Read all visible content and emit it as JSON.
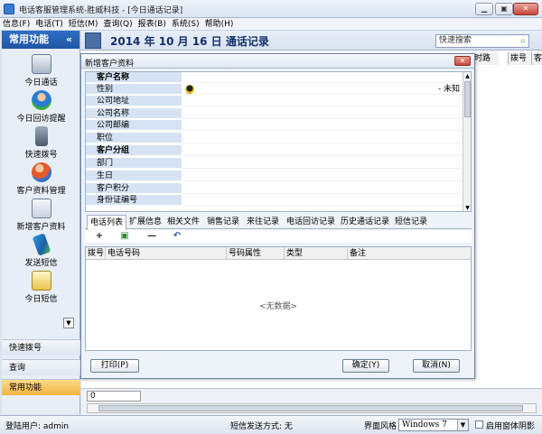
{
  "window": {
    "title": "电话客服管理系统-胜威科技 - [今日通话记录]",
    "minimize": "▁",
    "restore": "▣",
    "close": "✕"
  },
  "menu": [
    "信息(F)",
    "电话(T)",
    "短信(M)",
    "查询(Q)",
    "报表(B)",
    "系统(S)",
    "帮助(H)"
  ],
  "sidebar": {
    "header": "常用功能",
    "collapse": "«",
    "items": [
      {
        "label": "今日通话",
        "icon": "calendar-icon"
      },
      {
        "label": "今日回访提醒",
        "icon": "person-reminder-icon"
      },
      {
        "label": "快速拨号",
        "icon": "phone-icon"
      },
      {
        "label": "客户资料管理",
        "icon": "users-icon"
      },
      {
        "label": "新增客户资料",
        "icon": "contact-card-icon"
      },
      {
        "label": "发送短信",
        "icon": "mobile-icon"
      },
      {
        "label": "今日短信",
        "icon": "envelope-icon"
      }
    ],
    "scroll_down": "▼",
    "bottom_tabs": [
      "快速拨号",
      "查询",
      "常用功能"
    ]
  },
  "main": {
    "title": "2014 年 10 月 16 日 通话记录",
    "search_placeholder": "快速搜索",
    "search_icon": "⌕",
    "visible_columns": [
      "时路",
      "拨号",
      "客"
    ],
    "counter": "0"
  },
  "dialog": {
    "title": "新增客户资料",
    "close": "✕",
    "fields": [
      {
        "label": "客户名称",
        "group": true
      },
      {
        "label": "性别",
        "group": false
      },
      {
        "label": "公司地址",
        "group": false
      },
      {
        "label": "公司名称",
        "group": false
      },
      {
        "label": "公司邮编",
        "group": false
      },
      {
        "label": "职位",
        "group": false
      },
      {
        "label": "客户分组",
        "group": true
      },
      {
        "label": "部门",
        "group": false
      },
      {
        "label": "生日",
        "group": false
      },
      {
        "label": "客户积分",
        "group": false
      },
      {
        "label": "身份证编号",
        "group": false
      }
    ],
    "gender_value": "- 未知",
    "tabs": [
      "电话列表",
      "扩展信息",
      "相关文件",
      "销售记录",
      "来往记录",
      "电话回访记录",
      "历史通话记录",
      "短信记录"
    ],
    "toolbar": [
      "+",
      "▣",
      "—",
      "↶"
    ],
    "grid_columns": [
      "拨号",
      "电话号码",
      "号码属性",
      "类型",
      "备注"
    ],
    "empty_text": "<无数据>",
    "print_btn": "打印(P)",
    "ok_btn": "确定(Y)",
    "cancel_btn": "取消(N)"
  },
  "status": {
    "user": "登陆用户: admin",
    "sms_mode": "短信发送方式: 无",
    "style_label": "界面风格",
    "style_value": "Windows 7",
    "shadow_label": "启用窗体阴影"
  },
  "colors": {
    "sidebar_header": "#1f55a3",
    "active_tab": "#f2b441",
    "title_text": "#14306b"
  }
}
